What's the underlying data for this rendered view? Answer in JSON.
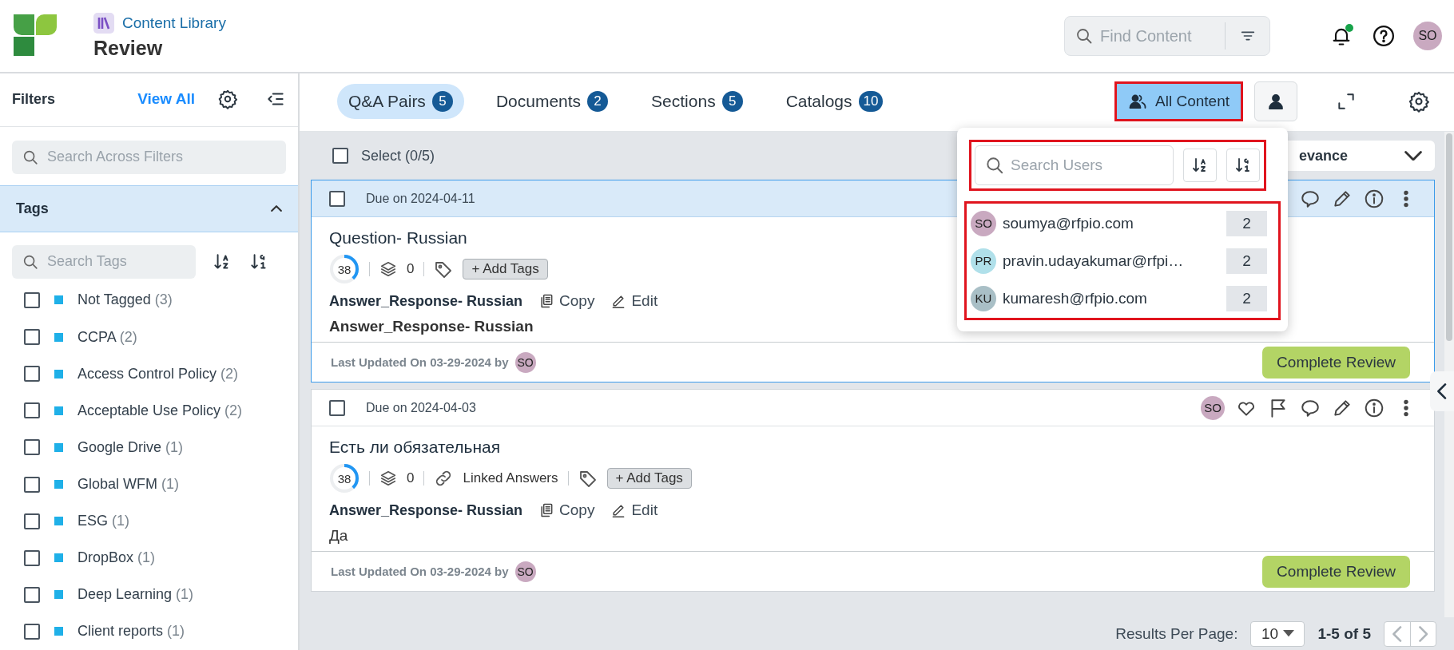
{
  "app": {
    "product": "Content Library",
    "page_title": "Review"
  },
  "header": {
    "search": {
      "placeholder": "Find Content"
    },
    "notifications": {
      "unread": true
    },
    "user_initials": "SO"
  },
  "sidebar": {
    "title": "Filters",
    "view_all": "View All",
    "search": {
      "placeholder": "Search Across Filters"
    },
    "section": {
      "title": "Tags",
      "expanded": true,
      "search": {
        "placeholder": "Search Tags"
      },
      "items": [
        {
          "label": "Not Tagged",
          "count": "(3)",
          "checked": false
        },
        {
          "label": "CCPA",
          "count": "(2)",
          "checked": false
        },
        {
          "label": "Access Control Policy",
          "count": "(2)",
          "checked": false
        },
        {
          "label": "Acceptable Use Policy",
          "count": "(2)",
          "checked": false
        },
        {
          "label": "Google Drive",
          "count": "(1)",
          "checked": false
        },
        {
          "label": "Global WFM",
          "count": "(1)",
          "checked": false
        },
        {
          "label": "ESG",
          "count": "(1)",
          "checked": false
        },
        {
          "label": "DropBox",
          "count": "(1)",
          "checked": false
        },
        {
          "label": "Deep Learning",
          "count": "(1)",
          "checked": false
        },
        {
          "label": "Client reports",
          "count": "(1)",
          "checked": false
        }
      ]
    }
  },
  "tabs": [
    {
      "label": "Q&A Pairs",
      "count": "5",
      "selected": true
    },
    {
      "label": "Documents",
      "count": "2",
      "selected": false
    },
    {
      "label": "Sections",
      "count": "5",
      "selected": false
    },
    {
      "label": "Catalogs",
      "count": "10",
      "selected": false
    }
  ],
  "view_toggle": [
    {
      "kind": "all",
      "label": "All Content",
      "selected": true
    },
    {
      "kind": "mine",
      "selected": false
    }
  ],
  "toolbar": {
    "select_label": "Select (0/5)",
    "select_all": false,
    "sort_value": "evance"
  },
  "cards": [
    {
      "due": "Due on 2024-04-11",
      "selected": true,
      "checked": false,
      "title": "Question- Russian",
      "score": "38",
      "level": 0.38,
      "versions": "0",
      "add_tags": "+ Add Tags",
      "answer_title": "Answer_Response- Russian",
      "copy": "Copy",
      "edit": "Edit",
      "answer": "Answer_Response- Russian",
      "answer_bold": true,
      "updated": "Last Updated On 03-29-2024 by",
      "updated_by": "SO",
      "complete": "Complete Review"
    },
    {
      "due": "Due on 2024-04-03",
      "selected": false,
      "checked": false,
      "owner": "SO",
      "title": "Есть ли обязательная",
      "score": "38",
      "level": 0.38,
      "versions": "0",
      "linked": "Linked Answers",
      "add_tags": "+ Add Tags",
      "answer_title": "Answer_Response- Russian",
      "copy": "Copy",
      "edit": "Edit",
      "answer": "Да",
      "answer_bold": false,
      "updated": "Last Updated On 03-29-2024 by",
      "updated_by": "SO",
      "complete": "Complete Review"
    }
  ],
  "popover": {
    "search": {
      "placeholder": "Search Users"
    },
    "users": [
      {
        "initials": "SO",
        "email": "soumya@rfpio.com",
        "count": "2",
        "color": "#c9a9c0"
      },
      {
        "initials": "PR",
        "email": "pravin.udayakumar@rfpi…",
        "count": "2",
        "color": "#b0e0ea"
      },
      {
        "initials": "KU",
        "email": "kumaresh@rfpio.com",
        "count": "2",
        "color": "#a9bfc6"
      }
    ]
  },
  "pagination": {
    "label": "Results Per Page:",
    "per_page": "10",
    "range": "1-5 of 5"
  }
}
